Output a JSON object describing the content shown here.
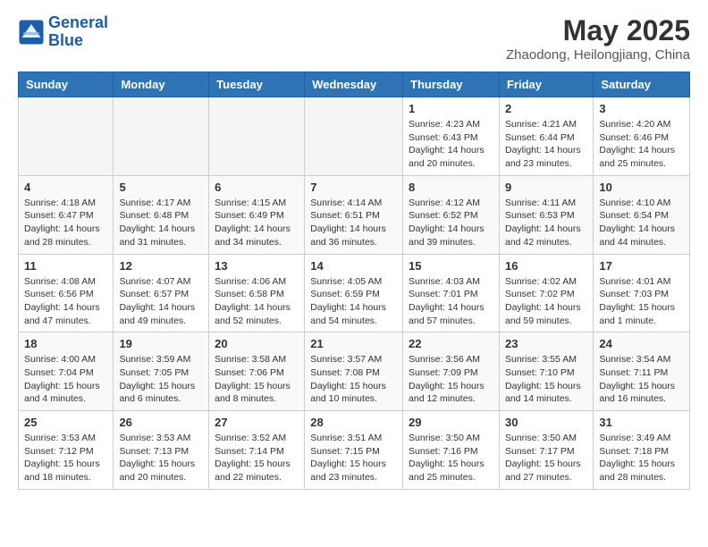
{
  "header": {
    "logo_line1": "General",
    "logo_line2": "Blue",
    "month_title": "May 2025",
    "location": "Zhaodong, Heilongjiang, China"
  },
  "days_of_week": [
    "Sunday",
    "Monday",
    "Tuesday",
    "Wednesday",
    "Thursday",
    "Friday",
    "Saturday"
  ],
  "weeks": [
    [
      {
        "day": "",
        "empty": true
      },
      {
        "day": "",
        "empty": true
      },
      {
        "day": "",
        "empty": true
      },
      {
        "day": "",
        "empty": true
      },
      {
        "day": "1",
        "sunrise": "4:23 AM",
        "sunset": "6:43 PM",
        "daylight": "14 hours and 20 minutes."
      },
      {
        "day": "2",
        "sunrise": "4:21 AM",
        "sunset": "6:44 PM",
        "daylight": "14 hours and 23 minutes."
      },
      {
        "day": "3",
        "sunrise": "4:20 AM",
        "sunset": "6:46 PM",
        "daylight": "14 hours and 25 minutes."
      }
    ],
    [
      {
        "day": "4",
        "sunrise": "4:18 AM",
        "sunset": "6:47 PM",
        "daylight": "14 hours and 28 minutes."
      },
      {
        "day": "5",
        "sunrise": "4:17 AM",
        "sunset": "6:48 PM",
        "daylight": "14 hours and 31 minutes."
      },
      {
        "day": "6",
        "sunrise": "4:15 AM",
        "sunset": "6:49 PM",
        "daylight": "14 hours and 34 minutes."
      },
      {
        "day": "7",
        "sunrise": "4:14 AM",
        "sunset": "6:51 PM",
        "daylight": "14 hours and 36 minutes."
      },
      {
        "day": "8",
        "sunrise": "4:12 AM",
        "sunset": "6:52 PM",
        "daylight": "14 hours and 39 minutes."
      },
      {
        "day": "9",
        "sunrise": "4:11 AM",
        "sunset": "6:53 PM",
        "daylight": "14 hours and 42 minutes."
      },
      {
        "day": "10",
        "sunrise": "4:10 AM",
        "sunset": "6:54 PM",
        "daylight": "14 hours and 44 minutes."
      }
    ],
    [
      {
        "day": "11",
        "sunrise": "4:08 AM",
        "sunset": "6:56 PM",
        "daylight": "14 hours and 47 minutes."
      },
      {
        "day": "12",
        "sunrise": "4:07 AM",
        "sunset": "6:57 PM",
        "daylight": "14 hours and 49 minutes."
      },
      {
        "day": "13",
        "sunrise": "4:06 AM",
        "sunset": "6:58 PM",
        "daylight": "14 hours and 52 minutes."
      },
      {
        "day": "14",
        "sunrise": "4:05 AM",
        "sunset": "6:59 PM",
        "daylight": "14 hours and 54 minutes."
      },
      {
        "day": "15",
        "sunrise": "4:03 AM",
        "sunset": "7:01 PM",
        "daylight": "14 hours and 57 minutes."
      },
      {
        "day": "16",
        "sunrise": "4:02 AM",
        "sunset": "7:02 PM",
        "daylight": "14 hours and 59 minutes."
      },
      {
        "day": "17",
        "sunrise": "4:01 AM",
        "sunset": "7:03 PM",
        "daylight": "15 hours and 1 minute."
      }
    ],
    [
      {
        "day": "18",
        "sunrise": "4:00 AM",
        "sunset": "7:04 PM",
        "daylight": "15 hours and 4 minutes."
      },
      {
        "day": "19",
        "sunrise": "3:59 AM",
        "sunset": "7:05 PM",
        "daylight": "15 hours and 6 minutes."
      },
      {
        "day": "20",
        "sunrise": "3:58 AM",
        "sunset": "7:06 PM",
        "daylight": "15 hours and 8 minutes."
      },
      {
        "day": "21",
        "sunrise": "3:57 AM",
        "sunset": "7:08 PM",
        "daylight": "15 hours and 10 minutes."
      },
      {
        "day": "22",
        "sunrise": "3:56 AM",
        "sunset": "7:09 PM",
        "daylight": "15 hours and 12 minutes."
      },
      {
        "day": "23",
        "sunrise": "3:55 AM",
        "sunset": "7:10 PM",
        "daylight": "15 hours and 14 minutes."
      },
      {
        "day": "24",
        "sunrise": "3:54 AM",
        "sunset": "7:11 PM",
        "daylight": "15 hours and 16 minutes."
      }
    ],
    [
      {
        "day": "25",
        "sunrise": "3:53 AM",
        "sunset": "7:12 PM",
        "daylight": "15 hours and 18 minutes."
      },
      {
        "day": "26",
        "sunrise": "3:53 AM",
        "sunset": "7:13 PM",
        "daylight": "15 hours and 20 minutes."
      },
      {
        "day": "27",
        "sunrise": "3:52 AM",
        "sunset": "7:14 PM",
        "daylight": "15 hours and 22 minutes."
      },
      {
        "day": "28",
        "sunrise": "3:51 AM",
        "sunset": "7:15 PM",
        "daylight": "15 hours and 23 minutes."
      },
      {
        "day": "29",
        "sunrise": "3:50 AM",
        "sunset": "7:16 PM",
        "daylight": "15 hours and 25 minutes."
      },
      {
        "day": "30",
        "sunrise": "3:50 AM",
        "sunset": "7:17 PM",
        "daylight": "15 hours and 27 minutes."
      },
      {
        "day": "31",
        "sunrise": "3:49 AM",
        "sunset": "7:18 PM",
        "daylight": "15 hours and 28 minutes."
      }
    ]
  ]
}
